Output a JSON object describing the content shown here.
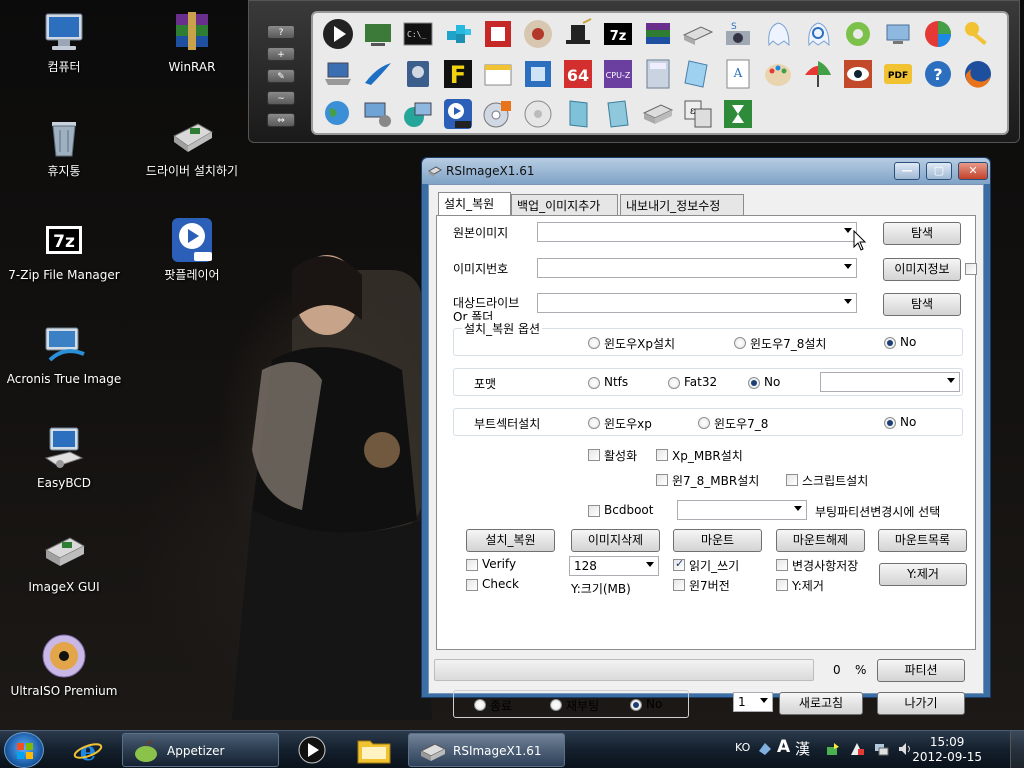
{
  "desktop": {
    "icons": [
      {
        "label": "컴퓨터"
      },
      {
        "label": "WinRAR"
      },
      {
        "label": "휴지통"
      },
      {
        "label": "드라이버 설치하기"
      },
      {
        "label": "7-Zip File Manager"
      },
      {
        "label": "팟플레이어"
      },
      {
        "label": "Acronis True Image"
      },
      {
        "label": "EasyBCD"
      },
      {
        "label": "ImageX GUI"
      },
      {
        "label": "UltraISO Premium"
      }
    ]
  },
  "dock": {
    "side_buttons": [
      "?",
      "+",
      "",
      "",
      ""
    ]
  },
  "window": {
    "title": "RSImageX1.61",
    "controls": {
      "minimize": "—",
      "maximize": "▢",
      "close": "✕"
    },
    "tabs": [
      "설치_복원",
      "백업_이미지추가",
      "내보내기_정보수정"
    ],
    "source_image_label": "원본이미지",
    "image_number_label": "이미지번호",
    "target_drive_label_1": "대상드라이브",
    "target_drive_label_2": "Or 폴더",
    "browse_button": "탐색",
    "image_info_button": "이미지정보",
    "browse_button_2": "탐색",
    "restore_options_legend": "설치_복원 옵션",
    "restore_options": {
      "opt1": "윈도우Xp설치",
      "opt2": "윈도우7_8설치",
      "opt3": "No"
    },
    "format_label": "포맷",
    "format_options": {
      "opt1": "Ntfs",
      "opt2": "Fat32",
      "opt3": "No"
    },
    "bootsector_label": "부트섹터설치",
    "bootsector_options": {
      "opt1": "윈도우xp",
      "opt2": "윈도우7_8",
      "opt3": "No"
    },
    "check_activate": "활성화",
    "check_xp_mbr": "Xp_MBR설치",
    "check_win78_mbr": "윈7_8_MBR설치",
    "check_script": "스크립트설치",
    "check_bcdboot": "Bcdboot",
    "boot_partition_text": "부팅파티션변경시에 선택",
    "actions": {
      "restore": "설치_복원",
      "delete_image": "이미지삭제",
      "mount": "마운트",
      "unmount": "마운트해제",
      "mount_list": "마운트목록"
    },
    "check_verify": "Verify",
    "check_check": "Check",
    "size_value": "128",
    "size_label": "Y:크기(MB)",
    "check_readwrite": "읽기_쓰기",
    "check_win7ver": "윈7버전",
    "check_save_changes": "변경사항저장",
    "check_y_remove": "Y:제거",
    "y_remove_button": "Y:제거",
    "progress_value": "0",
    "progress_unit": "%",
    "progress_fraction": 0,
    "partition_button": "파티션",
    "finish_options": {
      "opt1": "종료",
      "opt2": "재부팅",
      "opt3": "No"
    },
    "count_value": "1",
    "refresh_button": "새로고침",
    "exit_button": "나가기"
  },
  "taskbar": {
    "appetizer_label": "Appetizer",
    "rsimagex_label": "RSImageX1.61",
    "language": "KO",
    "ime_a": "A",
    "ime_han": "漢",
    "time": "15:09",
    "date": "2012-09-15"
  },
  "colors": {
    "accent": "#3a6ea5",
    "taskbar": "#14202d"
  }
}
